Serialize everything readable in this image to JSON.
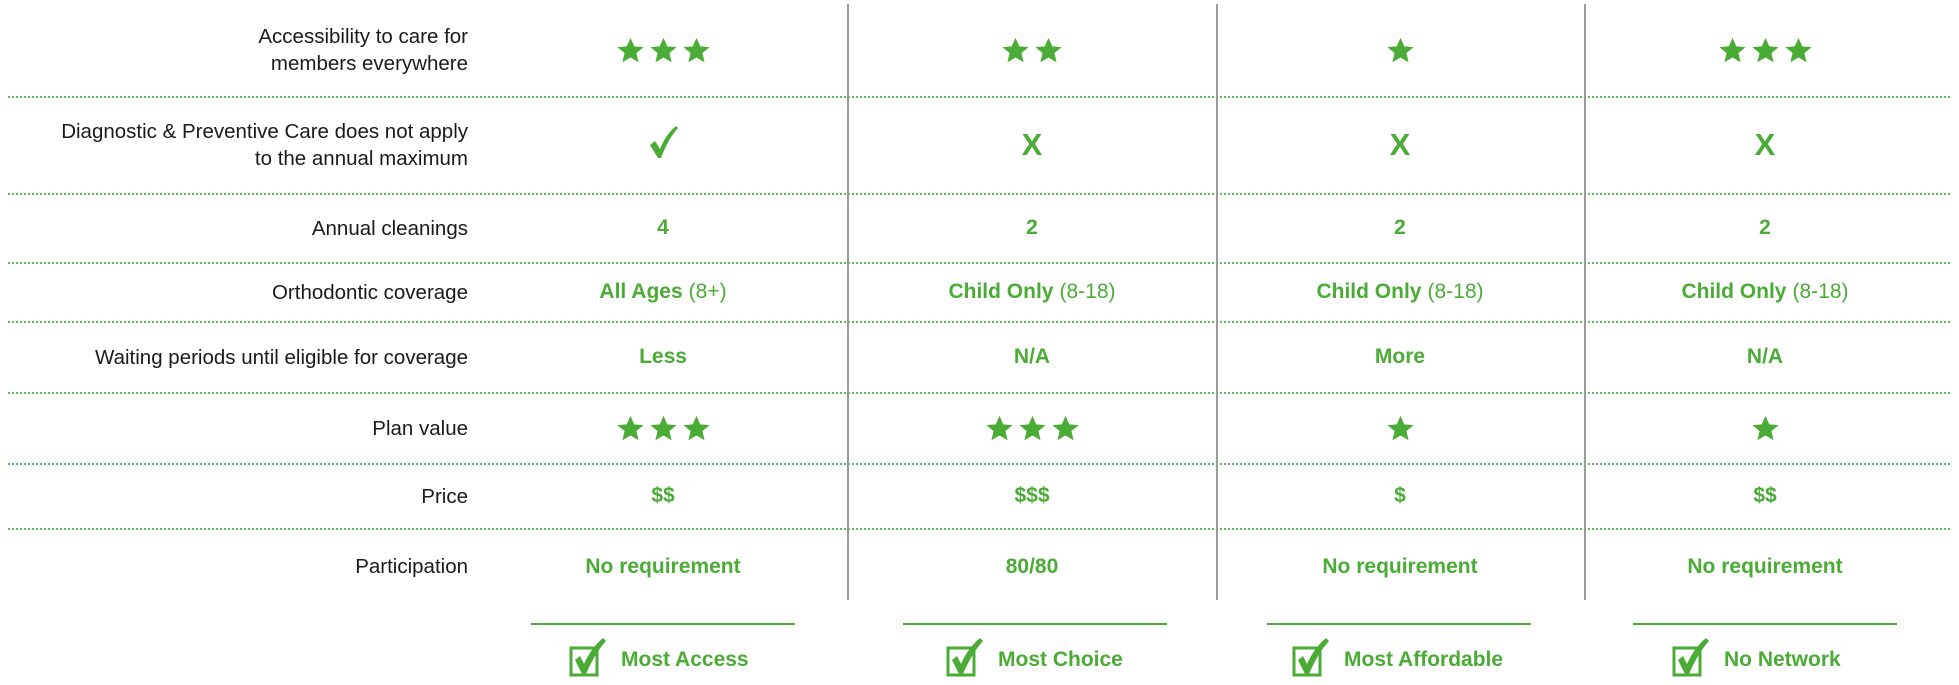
{
  "colors": {
    "accent": "#4aab35",
    "text": "#1a1a1a",
    "divider": "#9a9a9a"
  },
  "rows": [
    {
      "label": [
        "Accessibility to care for",
        "members everywhere"
      ],
      "cells": [
        {
          "stars": 3
        },
        {
          "stars": 2
        },
        {
          "stars": 1
        },
        {
          "stars": 3
        }
      ]
    },
    {
      "label": [
        "Diagnostic & Preventive Care does not apply",
        "to the annual maximum"
      ],
      "cells": [
        {
          "icon": "check-icon"
        },
        {
          "text": "X"
        },
        {
          "text": "X"
        },
        {
          "text": "X"
        }
      ]
    },
    {
      "label": [
        "Annual cleanings"
      ],
      "cells": [
        {
          "text": "4"
        },
        {
          "text": "2"
        },
        {
          "text": "2"
        },
        {
          "text": "2"
        }
      ]
    },
    {
      "label": [
        "Orthodontic coverage"
      ],
      "cells": [
        {
          "text": "All Ages",
          "paren": "(8+)"
        },
        {
          "text": "Child Only",
          "paren": "(8-18)"
        },
        {
          "text": "Child Only",
          "paren": "(8-18)"
        },
        {
          "text": "Child Only",
          "paren": "(8-18)"
        }
      ]
    },
    {
      "label": [
        "Waiting periods until eligible for coverage"
      ],
      "cells": [
        {
          "text": "Less"
        },
        {
          "text": "N/A"
        },
        {
          "text": "More"
        },
        {
          "text": "N/A"
        }
      ]
    },
    {
      "label": [
        "Plan value"
      ],
      "cells": [
        {
          "stars": 3
        },
        {
          "stars": 3
        },
        {
          "stars": 1
        },
        {
          "stars": 1
        }
      ]
    },
    {
      "label": [
        "Price"
      ],
      "cells": [
        {
          "text": "$$"
        },
        {
          "text": "$$$"
        },
        {
          "text": "$"
        },
        {
          "text": "$$"
        }
      ]
    },
    {
      "label": [
        "Participation"
      ],
      "cells": [
        {
          "text": "No requirement"
        },
        {
          "text": "80/80"
        },
        {
          "text": "No requirement"
        },
        {
          "text": "No requirement"
        }
      ]
    }
  ],
  "footer": [
    {
      "label": "Most Access",
      "icon": "checkbox-icon"
    },
    {
      "label": "Most Choice",
      "icon": "checkbox-icon"
    },
    {
      "label": "Most Affordable",
      "icon": "checkbox-icon"
    },
    {
      "label": "No Network",
      "icon": "checkbox-icon"
    }
  ]
}
